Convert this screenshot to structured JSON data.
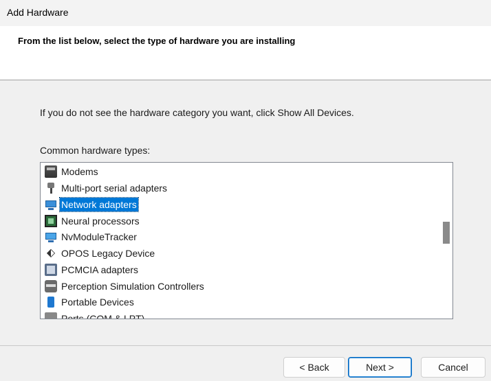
{
  "window": {
    "title": "Add Hardware"
  },
  "header": {
    "heading": "From the list below, select the type of hardware you are installing"
  },
  "main": {
    "info_text": "If you do not see the hardware category you want, click Show All Devices.",
    "list_label": "Common hardware types:",
    "items": [
      {
        "label": "Modems",
        "icon": "modem-icon"
      },
      {
        "label": "Multi-port serial adapters",
        "icon": "serial-adapter-icon"
      },
      {
        "label": "Network adapters",
        "icon": "network-adapter-icon",
        "selected": true
      },
      {
        "label": "Neural processors",
        "icon": "neural-processor-icon"
      },
      {
        "label": "NvModuleTracker",
        "icon": "nvmodule-icon"
      },
      {
        "label": "OPOS Legacy Device",
        "icon": "opos-device-icon"
      },
      {
        "label": "PCMCIA adapters",
        "icon": "pcmcia-icon"
      },
      {
        "label": "Perception Simulation Controllers",
        "icon": "perception-controller-icon"
      },
      {
        "label": "Portable Devices",
        "icon": "portable-device-icon"
      },
      {
        "label": "Ports (COM & LPT)",
        "icon": "ports-icon"
      }
    ],
    "selection_color": "#0078d7"
  },
  "footer": {
    "back_label": "< Back",
    "next_label": "Next >",
    "cancel_label": "Cancel"
  }
}
